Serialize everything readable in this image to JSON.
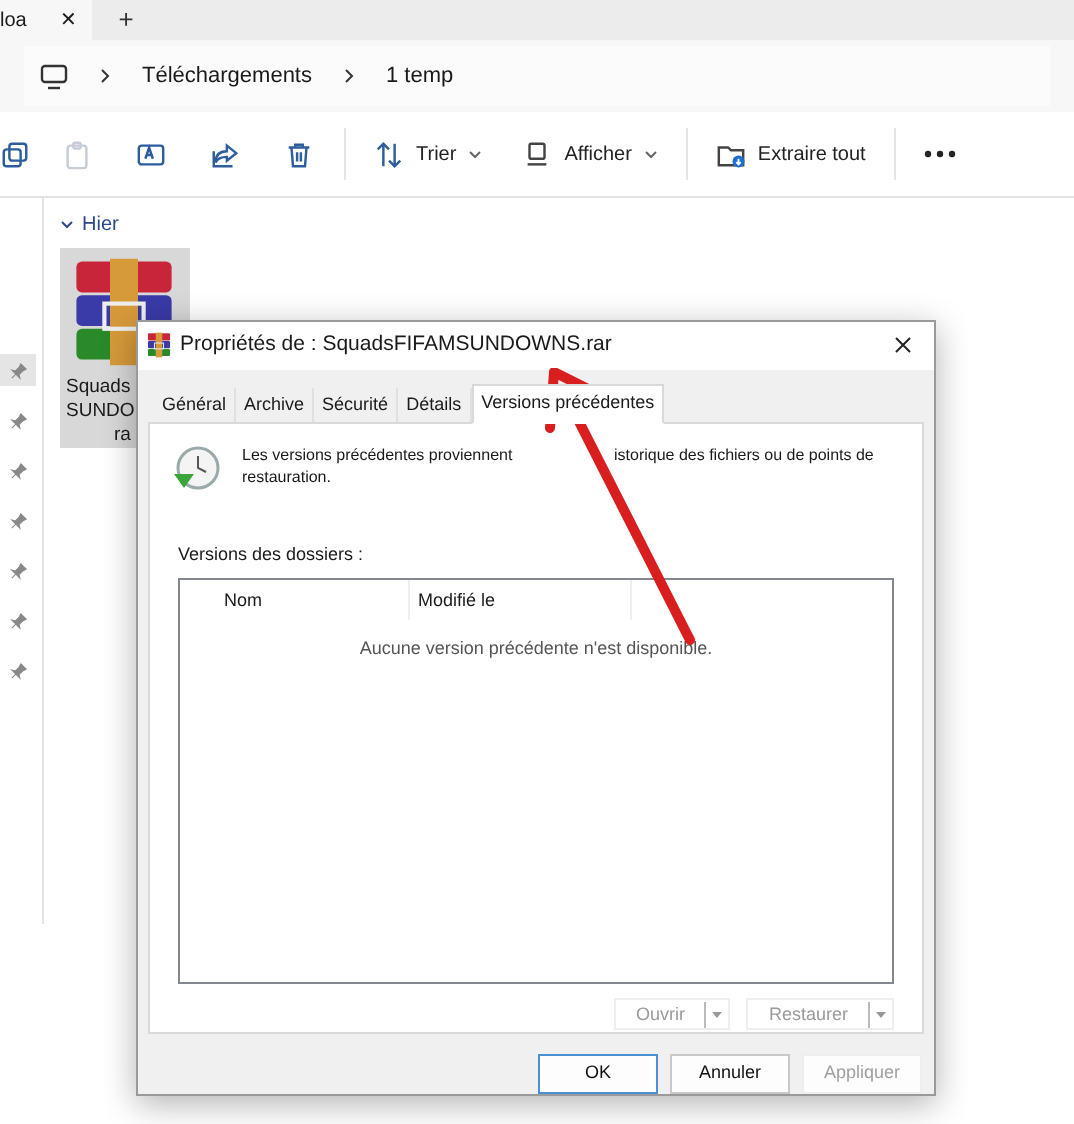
{
  "browser_tab": {
    "label": "loa",
    "close": "✕",
    "new_tab": "+"
  },
  "breadcrumb": [
    "Téléchargements",
    "1 temp"
  ],
  "toolbar": [
    {
      "kind": "copy",
      "disabled": false
    },
    {
      "kind": "paste",
      "disabled": true
    },
    {
      "kind": "rename",
      "disabled": false
    },
    {
      "kind": "share",
      "disabled": false
    },
    {
      "kind": "delete",
      "disabled": false
    },
    {
      "kind": "sort",
      "label": "Trier",
      "disabled": false
    },
    {
      "kind": "view",
      "label": "Afficher",
      "disabled": false
    },
    {
      "kind": "extract",
      "label": "Extraire tout",
      "disabled": false
    },
    {
      "kind": "more",
      "disabled": false
    }
  ],
  "pins": [
    {
      "selected": true
    },
    {
      "selected": false
    },
    {
      "selected": false
    },
    {
      "selected": false
    },
    {
      "selected": false
    },
    {
      "selected": false
    },
    {
      "selected": false
    }
  ],
  "group": {
    "label": "Hier",
    "expanded": true
  },
  "file": {
    "name_lines": [
      "Squads",
      "SUNDO",
      "ra"
    ],
    "selected": true
  },
  "dialog": {
    "title": "Propriétés de : SquadsFIFAMSUNDOWNS.rar",
    "tabs": [
      {
        "label": "Général",
        "selected": false
      },
      {
        "label": "Archive",
        "selected": false
      },
      {
        "label": "Sécurité",
        "selected": false
      },
      {
        "label": "Détails",
        "selected": false
      },
      {
        "label": "Versions précédentes",
        "selected": true
      }
    ],
    "description": [
      "Les versions précédentes proviennent",
      "istorique des fichiers ou de points de",
      "restauration."
    ],
    "section_label": "Versions des dossiers :",
    "columns": [
      "Nom",
      "Modifié le"
    ],
    "empty_message": "Aucune version précédente n'est disponible.",
    "split_buttons": [
      {
        "label": "Ouvrir",
        "disabled": true
      },
      {
        "label": "Restaurer",
        "disabled": true
      }
    ],
    "buttons": [
      {
        "label": "OK",
        "default": true,
        "disabled": false
      },
      {
        "label": "Annuler",
        "default": false,
        "disabled": false
      },
      {
        "label": "Appliquer",
        "default": false,
        "disabled": true
      }
    ]
  }
}
